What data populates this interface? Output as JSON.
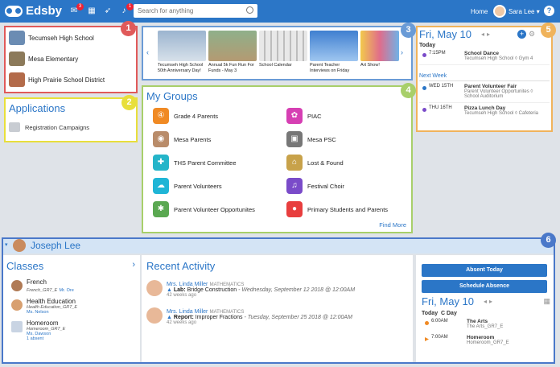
{
  "app": {
    "name": "Edsby"
  },
  "topbar": {
    "mail_badge": "3",
    "notif_badge": "1",
    "search_placeholder": "Search for anything",
    "home_label": "Home",
    "user_name": "Sara Lee",
    "user_caret": "▾",
    "help": "?"
  },
  "schools": [
    {
      "name": "Tecumseh High School"
    },
    {
      "name": "Mesa Elementary"
    },
    {
      "name": "High Prairie School District"
    }
  ],
  "applications": {
    "title": "Applications",
    "items": [
      {
        "label": "Registration Campaigns"
      }
    ]
  },
  "announcements": [
    {
      "caption": "Tecumseh High School 50th Anniversary Day!"
    },
    {
      "caption": "Annual 5k Fun Run For Funds - May 3"
    },
    {
      "caption": "School Calendar"
    },
    {
      "caption": "Parent Teacher Interviews on Friday"
    },
    {
      "caption": "Art Show!"
    }
  ],
  "my_groups": {
    "title": "My Groups",
    "find_more": "Find More",
    "items": [
      {
        "label": "Grade 4 Parents",
        "color": "#f08a24"
      },
      {
        "label": "PIAC",
        "color": "#d63fb3"
      },
      {
        "label": "Mesa Parents",
        "color": "#b98c6a"
      },
      {
        "label": "Mesa PSC",
        "color": "#777777"
      },
      {
        "label": "THS Parent Committee",
        "color": "#25b5c9"
      },
      {
        "label": "Lost & Found",
        "color": "#c8a24a"
      },
      {
        "label": "Parent Volunteers",
        "color": "#1fb5d6"
      },
      {
        "label": "Festival Choir",
        "color": "#7a4bc9"
      },
      {
        "label": "Parent Volunteer Opportunites",
        "color": "#5aa851"
      },
      {
        "label": "Primary Students and Parents",
        "color": "#e83e3e"
      }
    ]
  },
  "calendar_top": {
    "date": "Fri, May 10",
    "today_label": "Today",
    "next_week_label": "Next Week",
    "today_events": [
      {
        "time": "7:15PM",
        "name": "School Dance",
        "location": "Tecumseh High School ◊ Gym 4",
        "color": "#7a4bc9"
      }
    ],
    "next_events": [
      {
        "time": "WED 15TH",
        "name": "Parent Volunteer Fair",
        "location": "Parent Volunteer Opportunites ◊ School Auditorium",
        "color": "#2b76c7"
      },
      {
        "time": "THU 16TH",
        "name": "Pizza Lunch Day",
        "location": "Tecumseh High School ◊ Cafeteria",
        "color": "#7a4bc9"
      }
    ]
  },
  "student": {
    "name": "Joseph Lee"
  },
  "classes": {
    "title": "Classes",
    "items": [
      {
        "name": "French",
        "code": "French_GR7_E",
        "teacher": "Mr. Ore",
        "avatar_color": "#b07a55"
      },
      {
        "name": "Health Education",
        "code": "Health Education_GR7_E",
        "teacher": "Ms. Nelson",
        "avatar_color": "#d8a070"
      },
      {
        "name": "Homeroom",
        "code": "Homeroom_GR7_E",
        "teacher": "Ms. Dawson",
        "extra": "1 absent",
        "avatar_color": "#c9d4e3"
      }
    ]
  },
  "recent_activity": {
    "title": "Recent Activity",
    "items": [
      {
        "teacher": "Mrs. Linda Miller",
        "subject": "MATHEMATICS",
        "kind": "Lab:",
        "title": "Bridge Construction",
        "due": "- Wednesday, September 12 2018 @ 12:00AM",
        "ago": "42 weeks ago"
      },
      {
        "teacher": "Mrs. Linda Miller",
        "subject": "MATHEMATICS",
        "kind": "Report:",
        "title": "Improper Fractions",
        "due": "- Tuesday, September 25 2018 @ 12:00AM",
        "ago": "42 weeks ago"
      }
    ]
  },
  "right_panel": {
    "absent_today": "Absent Today",
    "schedule_absence": "Schedule Absence",
    "date": "Fri, May 10",
    "today_label": "Today",
    "day_label": "C Day",
    "events": [
      {
        "time": "6:00AM",
        "name": "The Arts",
        "code": "The Arts_GR7_E",
        "color": "#f08a24"
      },
      {
        "time": "7:00AM",
        "name": "Homeroom",
        "code": "Homeroom_GR7_E",
        "color": "#f08a24"
      }
    ]
  },
  "callouts": [
    "1",
    "2",
    "3",
    "4",
    "5",
    "6"
  ]
}
